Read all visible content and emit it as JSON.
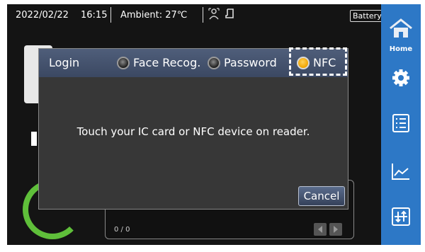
{
  "status": {
    "date": "2022/02/22",
    "time": "16:15",
    "ambient": "Ambient: 27℃",
    "battery": "Battery"
  },
  "sidebar": {
    "home_label": "Home",
    "items": [
      {
        "name": "home-icon"
      },
      {
        "name": "gear-icon"
      },
      {
        "name": "list-icon"
      },
      {
        "name": "chart-icon"
      },
      {
        "name": "transfer-icon"
      }
    ]
  },
  "background": {
    "counter": "0 / 0"
  },
  "dialog": {
    "title": "Login",
    "options": [
      {
        "label": "Face Recog.",
        "selected": false
      },
      {
        "label": "Password",
        "selected": false
      },
      {
        "label": "NFC",
        "selected": true
      }
    ],
    "message": "Touch your IC card or NFC device on reader.",
    "cancel_label": "Cancel"
  },
  "colors": {
    "sidebar": "#2d78c6",
    "header": "#4f5e7a",
    "selected_dot": "#f0a400",
    "gauge": "#5fbf3a"
  }
}
